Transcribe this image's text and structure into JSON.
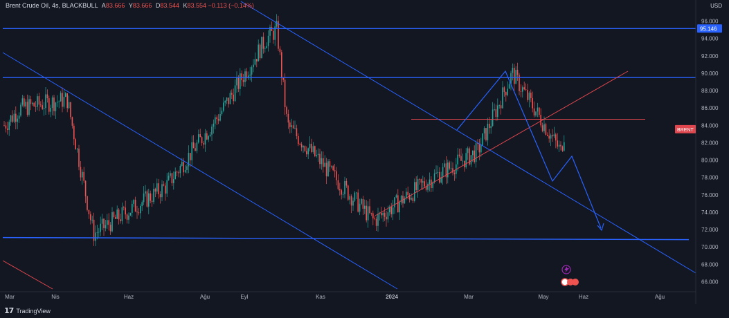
{
  "header": {
    "symbol": "Brent Crude Oil",
    "interval": "4s",
    "broker": "BLACKBULL",
    "ohlc": [
      {
        "key": "A",
        "value": "83.666"
      },
      {
        "key": "Y",
        "value": "83.666"
      },
      {
        "key": "D",
        "value": "83.544"
      },
      {
        "key": "K",
        "value": "83.554"
      }
    ],
    "change": "−0.113 (−0.14%)"
  },
  "currency": "USD",
  "brand": "TradingView",
  "colors": {
    "background": "#131722",
    "up": "#26a69a",
    "down": "#ef5350",
    "trendline_blue": "#2962ff",
    "trendline_red": "#e0464e"
  },
  "chart_data": {
    "type": "candlestick",
    "title": "Brent Crude Oil, 4s, BLACKBULL",
    "x_ticks": [
      "Mar",
      "Nis",
      "Haz",
      "Ağu",
      "Eyl",
      "Kas",
      "2024",
      "Mar",
      "May",
      "Haz",
      "Ağu"
    ],
    "y_ticks": [
      66,
      68,
      70,
      72,
      74,
      76,
      78,
      80,
      82,
      84,
      86,
      88,
      90,
      92,
      94,
      96
    ],
    "ylim": [
      65,
      97
    ],
    "price_anchors": {
      "x": [
        "Mar",
        "Nis",
        "Nis",
        "Haz",
        "Haz",
        "Ağu",
        "Eyl",
        "Eyl",
        "Kas",
        "Kas",
        "2024",
        "2024",
        "Mar",
        "May",
        "May"
      ],
      "y": [
        84,
        86,
        87,
        71.5,
        77,
        85,
        94,
        95,
        84,
        73,
        78,
        81,
        90,
        81,
        83.55
      ]
    },
    "projection_path": [
      83.5,
      76.5,
      79.5,
      71.2
    ],
    "horizontal_levels": [
      {
        "value": 95.146,
        "color": "blue",
        "label": "95.146"
      },
      {
        "value": 89.5,
        "color": "blue"
      },
      {
        "value": 71.0,
        "color": "blue"
      },
      {
        "value": 84.7,
        "color": "red"
      }
    ],
    "symbol_badge": "BRENT",
    "last_price": 83.554,
    "grid": false
  }
}
